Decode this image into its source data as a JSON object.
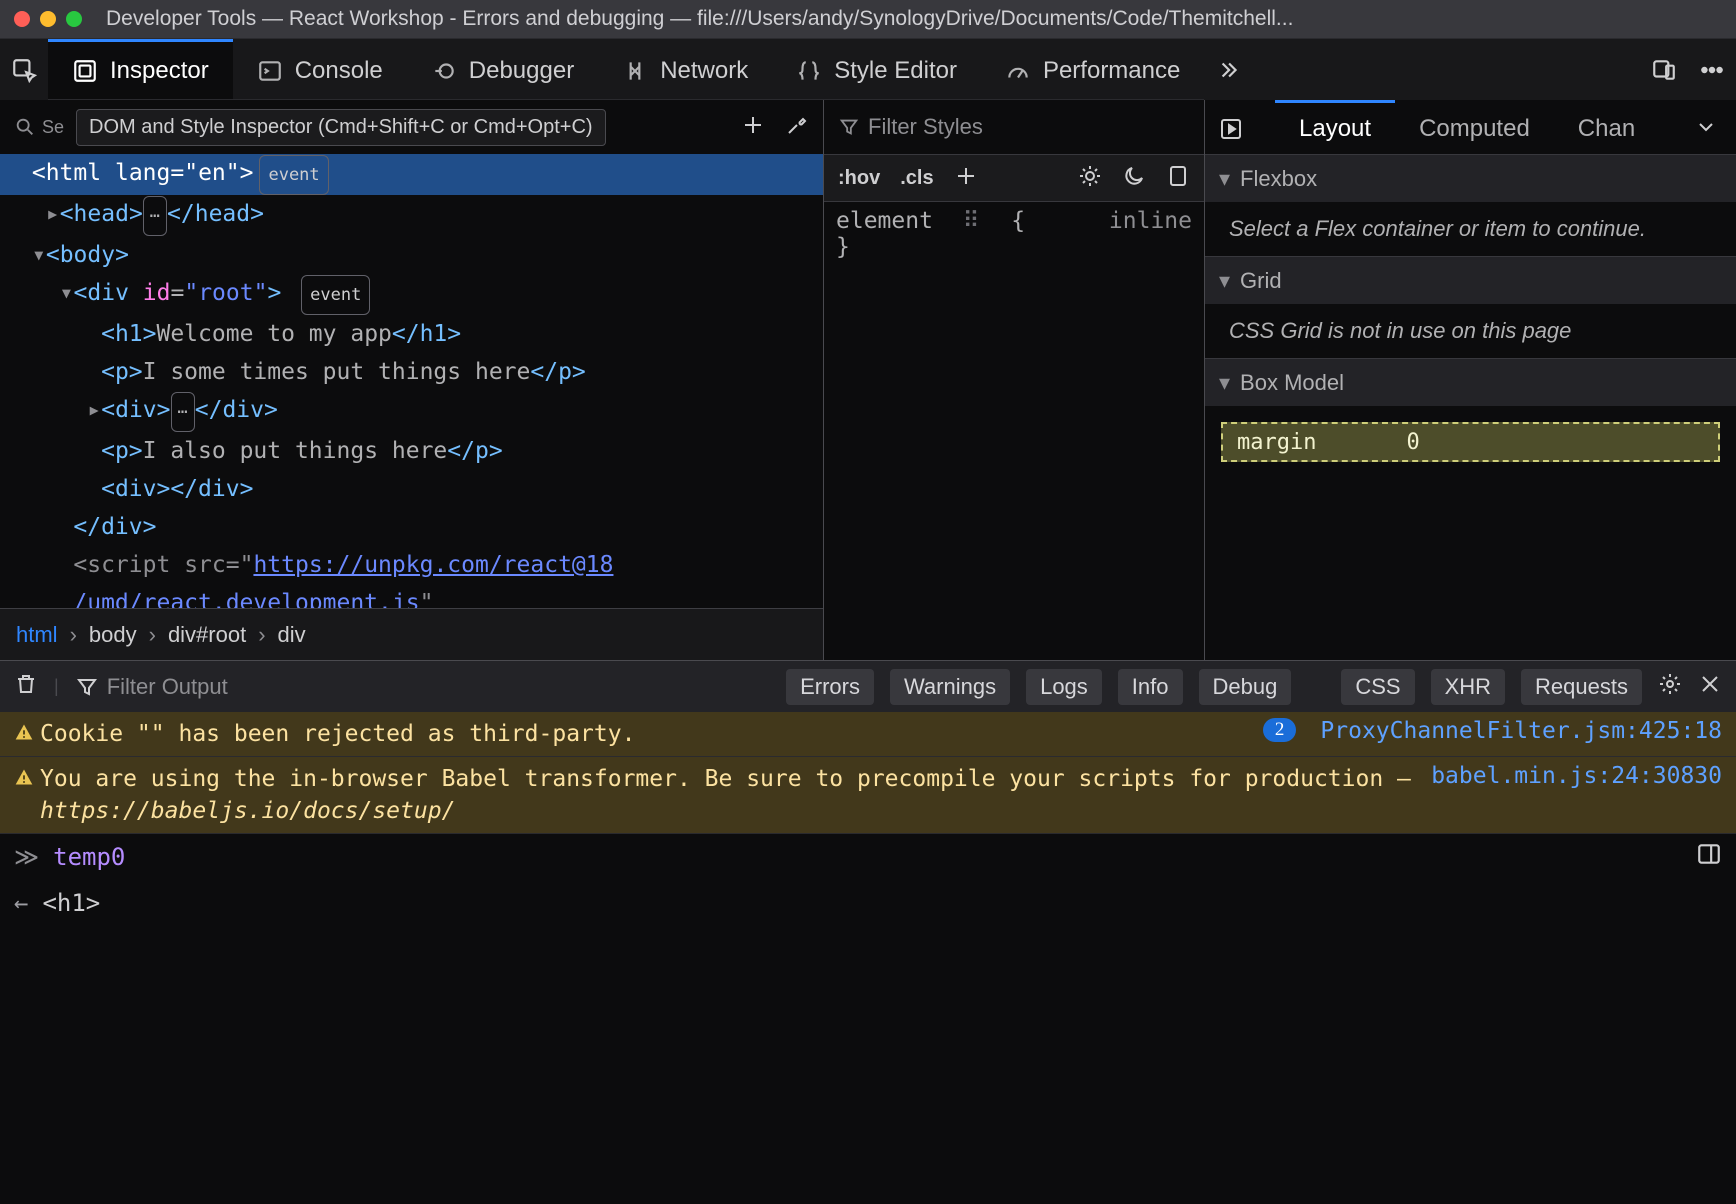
{
  "window": {
    "title": "Developer Tools — React Workshop - Errors and debugging — file:///Users/andy/SynologyDrive/Documents/Code/Themitchell..."
  },
  "mainTabs": {
    "selector": " ",
    "items": [
      "Inspector",
      "Console",
      "Debugger",
      "Network",
      "Style Editor",
      "Performance"
    ],
    "tooltip": "DOM and Style Inspector (Cmd+Shift+C or Cmd+Opt+C)"
  },
  "markup": {
    "searchPlaceholder": "Se",
    "tree": {
      "l0": "<html lang=\"en\">",
      "l0_badge": "event",
      "l1_open": "<head>",
      "l1_close": "</head>",
      "l2": "<body>",
      "l3_open": "<div id=\"root\">",
      "l3_badge": "event",
      "l4": "<h1>Welcome to my app</h1>",
      "l5": "<p>I some times put things here</p>",
      "l6_open": "<div>",
      "l6_close": "</div>",
      "l7": "<p>I also put things here</p>",
      "l8": "<div></div>",
      "l9": "</div>",
      "l10a": "<script src=\"",
      "l10b": "https://unpkg.com/react@18",
      "l10c": "/umd/react.development.js",
      "l10d": "\""
    },
    "breadcrumb": [
      "html",
      "body",
      "div#root",
      "div"
    ]
  },
  "styles": {
    "filterPlaceholder": "Filter Styles",
    "hov": ":hov",
    "cls": ".cls",
    "ruleHead": "element",
    "ruleOpen": "{",
    "ruleClose": "}",
    "inlineLabel": "inline"
  },
  "layout": {
    "tabs": [
      "Layout",
      "Computed",
      "Chan"
    ],
    "flex_head": "Flexbox",
    "flex_body": "Select a Flex container or item to continue.",
    "grid_head": "Grid",
    "grid_body": "CSS Grid is not in use on this page",
    "box_head": "Box Model",
    "margin_label": "margin",
    "margin_val": "0"
  },
  "console": {
    "filterPlaceholder": "Filter Output",
    "chips1": [
      "Errors",
      "Warnings",
      "Logs",
      "Info",
      "Debug"
    ],
    "chips2": [
      "CSS",
      "XHR",
      "Requests"
    ],
    "msgs": [
      {
        "kind": "warn",
        "text": "Cookie \"\" has been rejected as third-party.",
        "count": "2",
        "loc": "ProxyChannelFilter.jsm:425:18"
      },
      {
        "kind": "warn",
        "text": "You are using the in-browser Babel transformer. Be sure to precompile your scripts for production – ",
        "link": "https://babeljs.io/docs/setup/",
        "loc": "babel.min.js:24:30830"
      }
    ],
    "inputVal": "temp0",
    "outputVal": "<h1>"
  }
}
